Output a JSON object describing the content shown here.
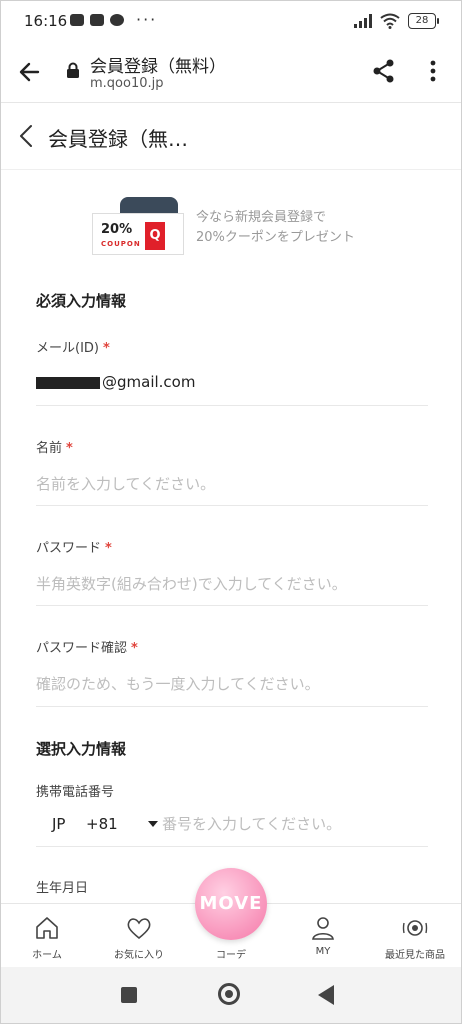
{
  "status_bar": {
    "time": "16:16",
    "dots": "···",
    "battery": "28"
  },
  "browser": {
    "title": "会員登録（無料）",
    "url": "m.qoo10.jp"
  },
  "page_header": {
    "title": "会員登録（無…"
  },
  "banner": {
    "coupon_pct": "20%",
    "coupon_word": "COUPON",
    "coupon_q": "Q",
    "text_line1": "今なら新規会員登録で",
    "text_line2": "20%クーポンをプレゼント"
  },
  "form": {
    "required_section": "必須入力情報",
    "email": {
      "label": "メール(ID)",
      "required": "*",
      "value_suffix": "@gmail.com"
    },
    "name": {
      "label": "名前",
      "required": "*",
      "placeholder": "名前を入力してください。"
    },
    "password": {
      "label": "パスワード",
      "required": "*",
      "placeholder": "半角英数字(組み合わせ)で入力してください。"
    },
    "password_confirm": {
      "label": "パスワード確認",
      "required": "*",
      "placeholder": "確認のため、もう一度入力してください。"
    },
    "optional_section": "選択入力情報",
    "phone": {
      "label": "携帯電話番号",
      "country": "JP",
      "code": "+81",
      "placeholder": "番号を入力してください。"
    },
    "birthday": {
      "label": "生年月日"
    }
  },
  "bottom_nav": {
    "home": "ホーム",
    "favorites": "お気に入り",
    "coordi": "コーデ",
    "my": "MY",
    "recent": "最近見た商品",
    "move": "MOVE"
  },
  "colors": {
    "required": "#e0443c",
    "move_pink": "#f578a8",
    "coupon_red": "#e0202a"
  }
}
